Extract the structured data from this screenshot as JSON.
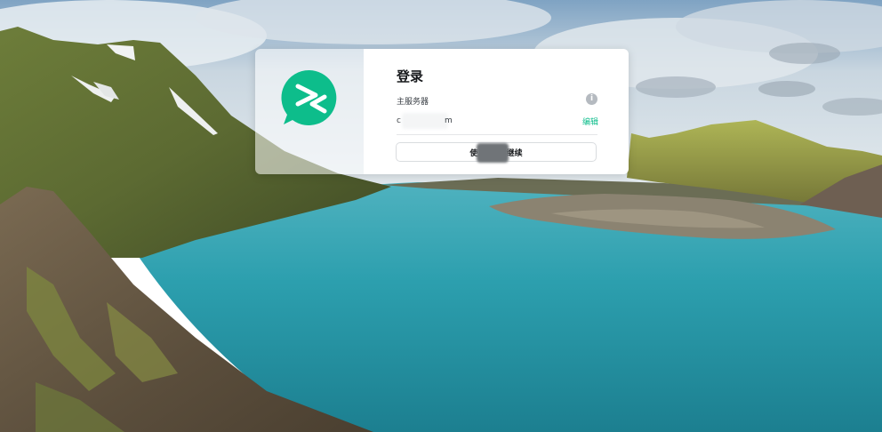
{
  "login": {
    "title": "登录",
    "server_label": "主服务器",
    "server_value_prefix": "c",
    "server_value_suffix": "m",
    "edit_label": "编辑",
    "continue_label": "使用SSO 继续",
    "info_icon": "info-icon"
  },
  "icons": {
    "logo": "element-logo-icon",
    "info": "info-icon"
  },
  "colors": {
    "brand_green": "#0dbd8b",
    "text_primary": "#17191c",
    "text_secondary": "#3a3f45"
  }
}
